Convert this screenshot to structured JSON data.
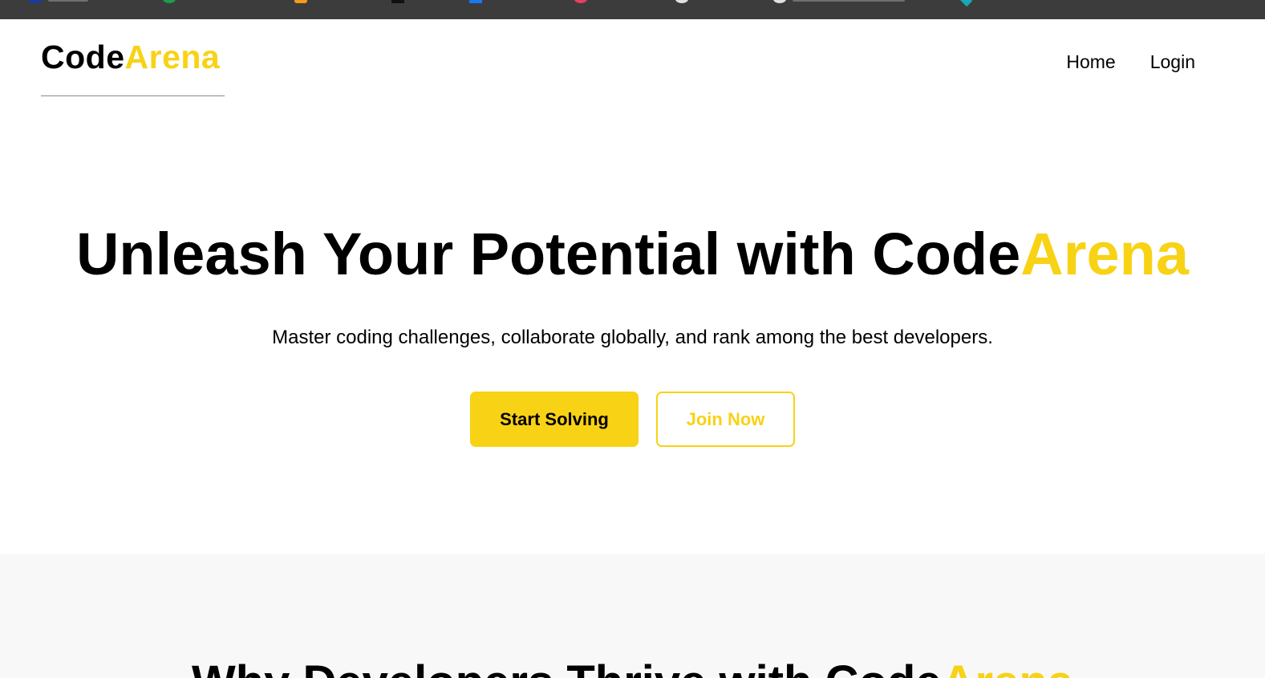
{
  "brand": {
    "name_part1": "Code",
    "name_part2": "Arena",
    "accent_color": "#f8d215"
  },
  "nav": {
    "items": [
      {
        "label": "Home"
      },
      {
        "label": "Login"
      }
    ]
  },
  "hero": {
    "title_part1": "Unleash Your Potential with Code",
    "title_part2": "Arena",
    "subtitle": "Master coding challenges, collaborate globally, and rank among the best developers.",
    "primary_button": "Start Solving",
    "secondary_button": "Join Now"
  },
  "features": {
    "title_part1": "Why Developers Thrive with Code",
    "title_part2": "Arena"
  }
}
